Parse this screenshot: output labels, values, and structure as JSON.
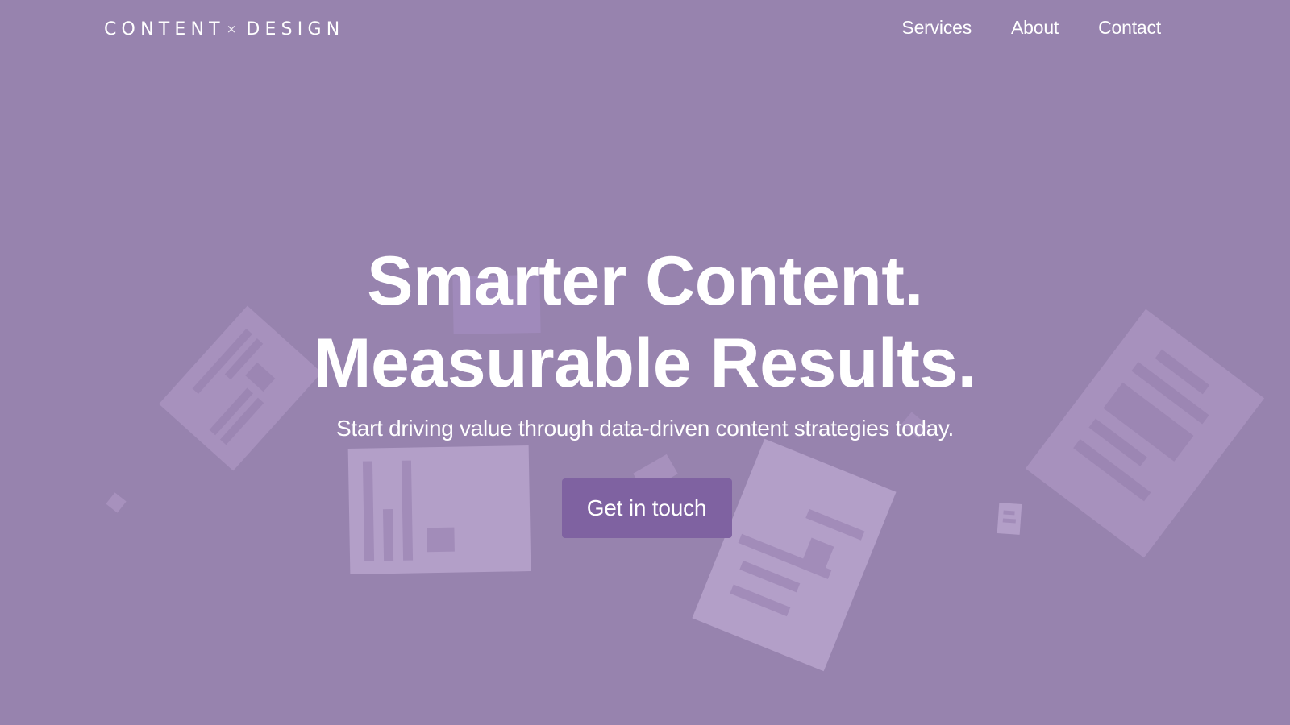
{
  "brand": {
    "logo_left": "CONTENT",
    "logo_sep": "×",
    "logo_right": "DESIGN"
  },
  "nav": {
    "items": [
      {
        "label": "Services"
      },
      {
        "label": "About"
      },
      {
        "label": "Contact"
      }
    ]
  },
  "hero": {
    "headline_line1": "Smarter Content.",
    "headline_line2": "Measurable Results.",
    "subheadline": "Start driving value through data-driven content strategies today.",
    "cta_label": "Get in touch"
  },
  "colors": {
    "background": "#9783ae",
    "cta_background": "#7f62a1",
    "text": "#ffffff",
    "decor_card": "#b39fc8",
    "decor_card_muted": "#a791bd",
    "decor_bar": "#9c86b3"
  }
}
